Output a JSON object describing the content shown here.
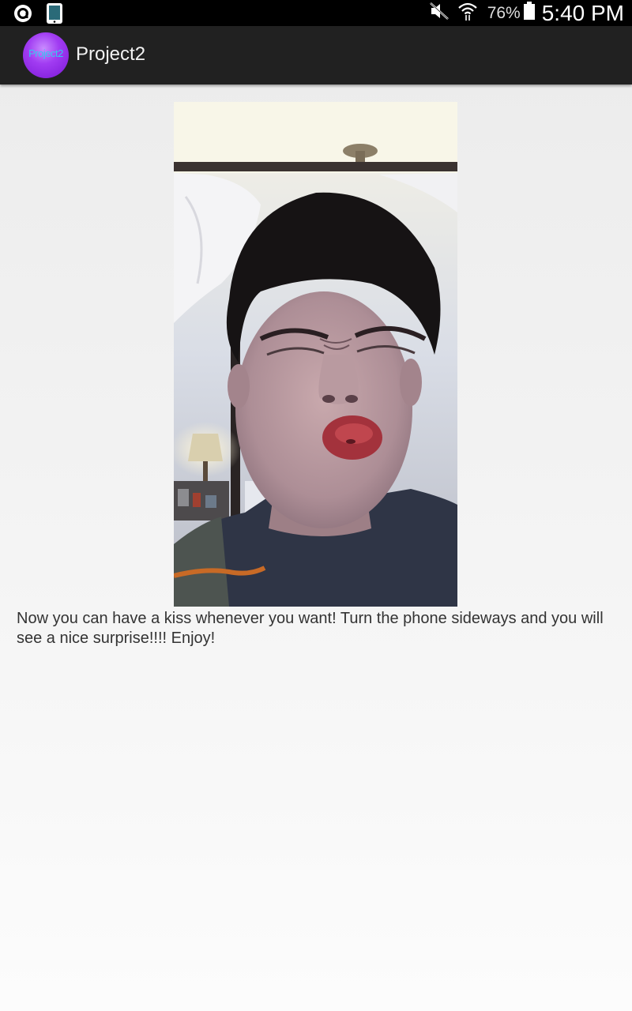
{
  "status_bar": {
    "battery_percent": "76%",
    "time": "5:40 PM",
    "icons": [
      "notification-icon",
      "phone-icon",
      "mute-icon",
      "wifi-icon",
      "battery-icon"
    ]
  },
  "action_bar": {
    "app_icon_text": "Project2",
    "title": "Project2",
    "app_icon_color": "#a13cf2"
  },
  "content": {
    "message": "Now you can have a kiss whenever you want! Turn the phone sideways and you will see a nice surprise!!!! Enjoy!"
  }
}
